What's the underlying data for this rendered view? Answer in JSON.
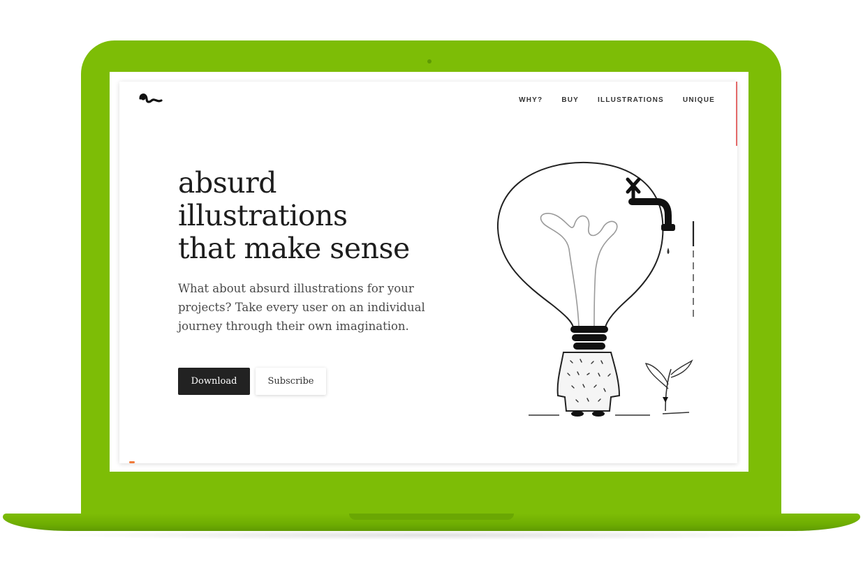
{
  "colors": {
    "laptop_green": "#7dbd06",
    "screen_white": "#ffffff",
    "button_dark": "#222222",
    "text_dark": "#1d1d1d",
    "scroll_accent": "#e46a6a"
  },
  "logo": {
    "icon": "squiggle-logo-icon"
  },
  "nav": {
    "items": [
      {
        "label": "WHY?"
      },
      {
        "label": "BUY"
      },
      {
        "label": "ILLUSTRATIONS"
      },
      {
        "label": "UNIQUE"
      }
    ]
  },
  "hero": {
    "title_lines": [
      "absurd",
      "illustrations",
      "that make sense"
    ],
    "description": "What about absurd illustrations for your projects? Take every user on an individual journey through their own imagination.",
    "buttons": {
      "download": "Download",
      "subscribe": "Subscribe"
    }
  },
  "illustration": {
    "icon": "lightbulb-person-faucet-illustration"
  }
}
